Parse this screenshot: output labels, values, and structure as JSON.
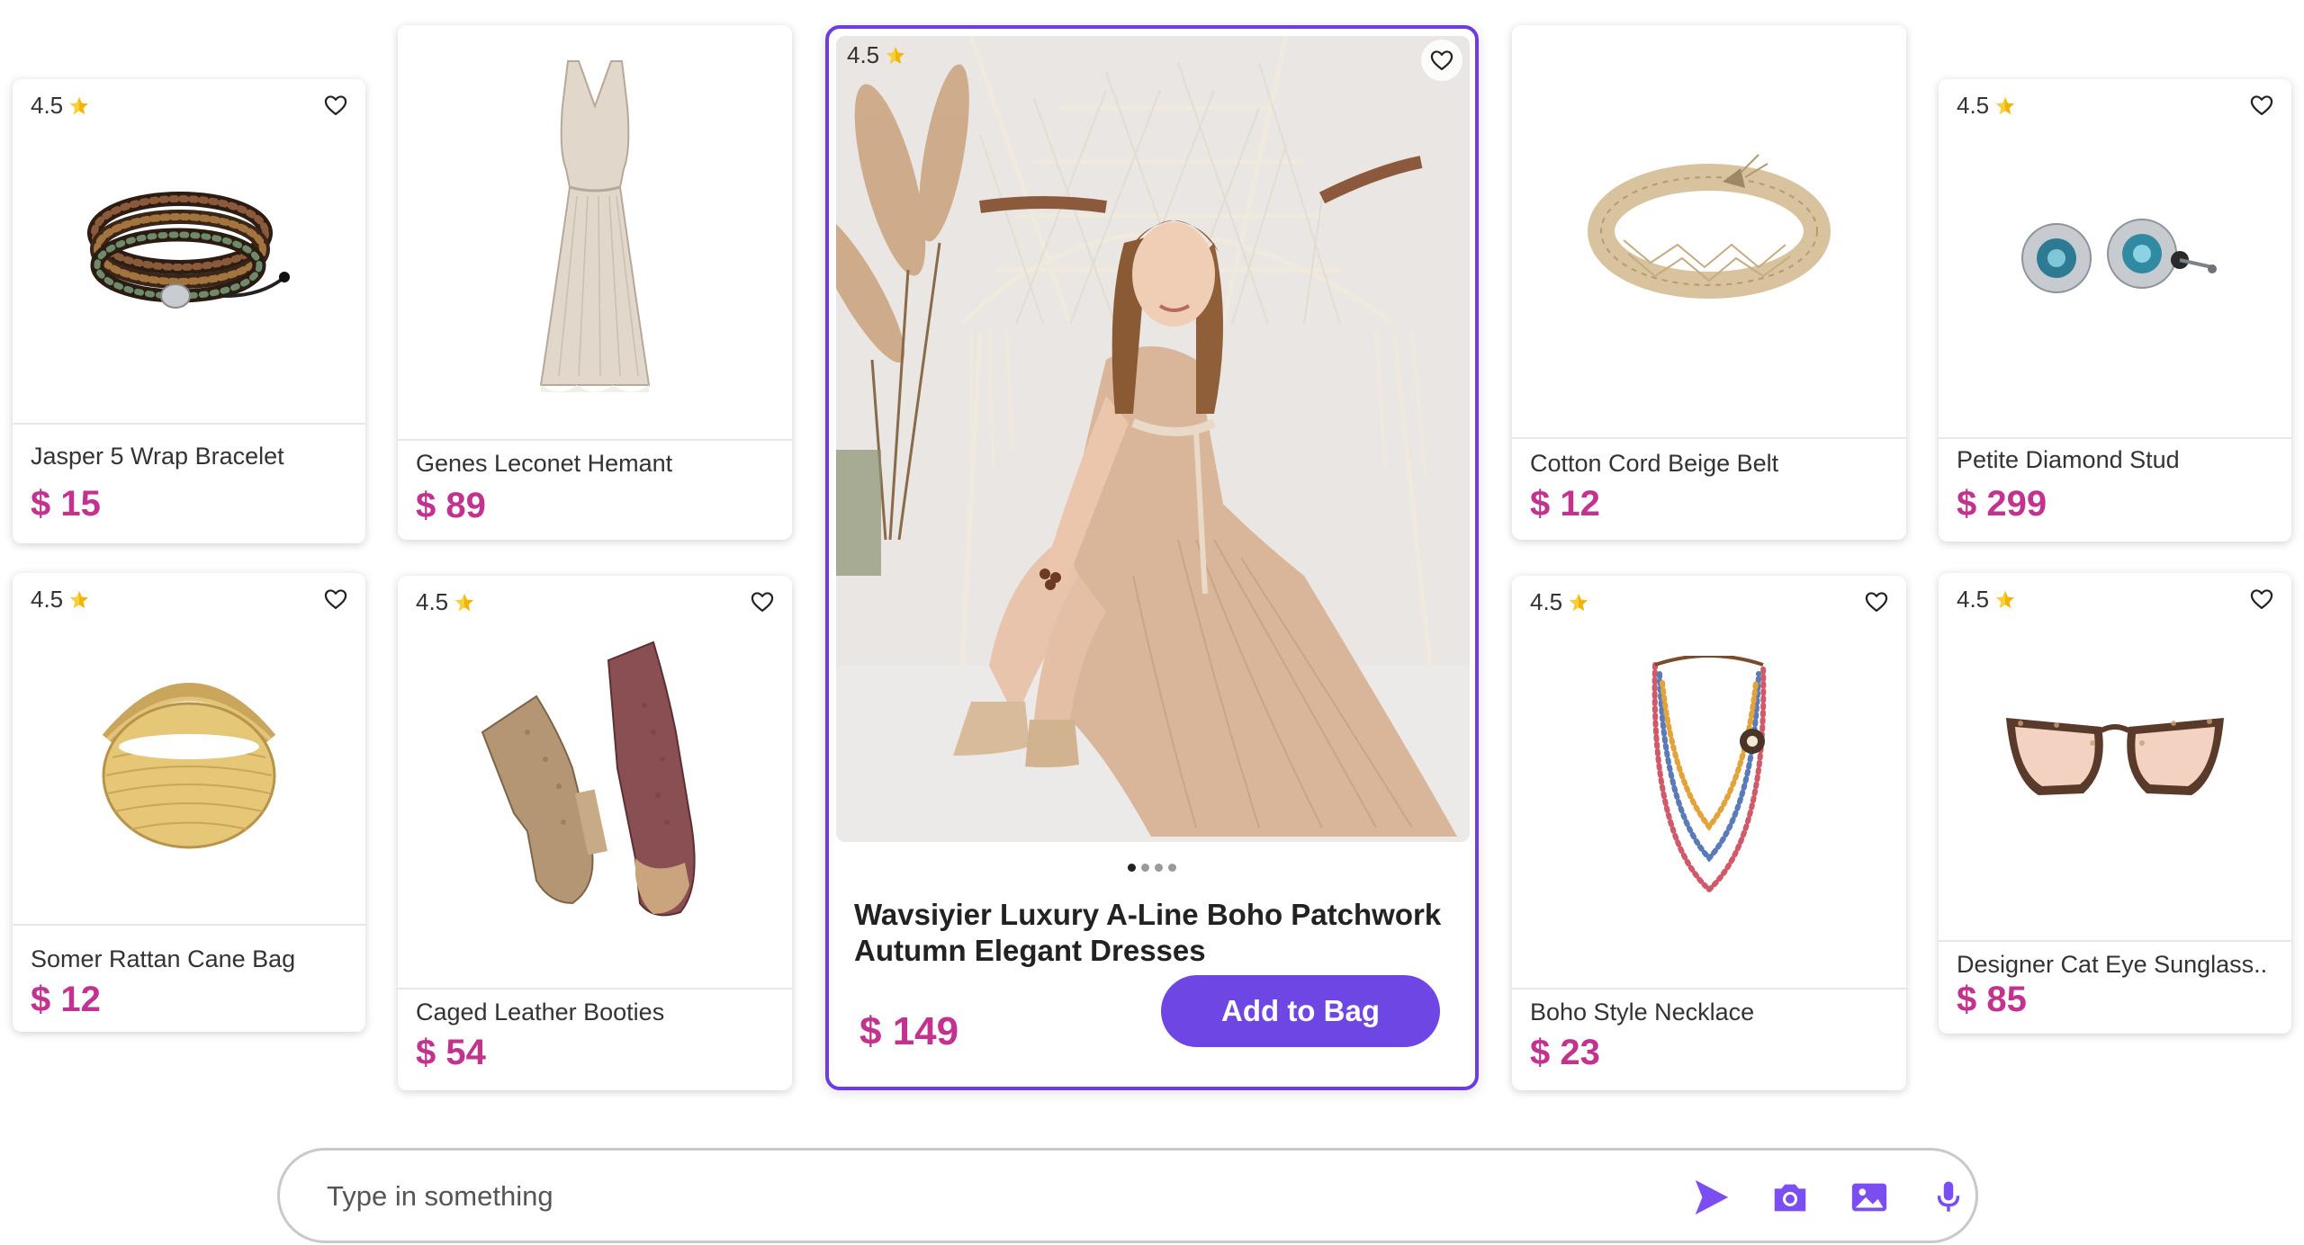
{
  "colors": {
    "accent": "#6e46e3",
    "price": "#c2338f",
    "star": "#f3b300"
  },
  "products": [
    {
      "rating": "4.5",
      "name": "Jasper 5 Wrap Bracelet",
      "price": "$ 15",
      "icon": "beaded-wrap-bracelet"
    },
    {
      "rating": "4.5",
      "name": "Somer Rattan Cane Bag",
      "price": "$ 12",
      "icon": "rattan-bag"
    },
    {
      "name": "Genes Leconet Hemant",
      "price": "$ 89",
      "icon": "linen-dress"
    },
    {
      "rating": "4.5",
      "name": "Caged Leather Booties",
      "price": "$ 54",
      "icon": "leather-booties"
    },
    {
      "name": "Cotton Cord Beige Belt",
      "price": "$ 12",
      "icon": "cord-belt"
    },
    {
      "rating": "4.5",
      "name": "Boho Style Necklace",
      "price": "$ 23",
      "icon": "beaded-necklace"
    },
    {
      "rating": "4.5",
      "name": "Petite Diamond Stud",
      "price": "$ 299",
      "icon": "stud-earrings"
    },
    {
      "rating": "4.5",
      "name": "Designer Cat Eye Sunglass..",
      "price": "$ 85",
      "icon": "sunglasses"
    }
  ],
  "featured": {
    "rating": "4.5",
    "title": "Wavsiyier Luxury A-Line Boho Patchwork Autumn Elegant Dresses",
    "price": "$ 149",
    "add_label": "Add to Bag",
    "active_slide": 1,
    "slides": 4
  },
  "chat": {
    "placeholder": "Type in something",
    "icons": [
      "send-icon",
      "camera-icon",
      "image-icon",
      "microphone-icon"
    ]
  }
}
